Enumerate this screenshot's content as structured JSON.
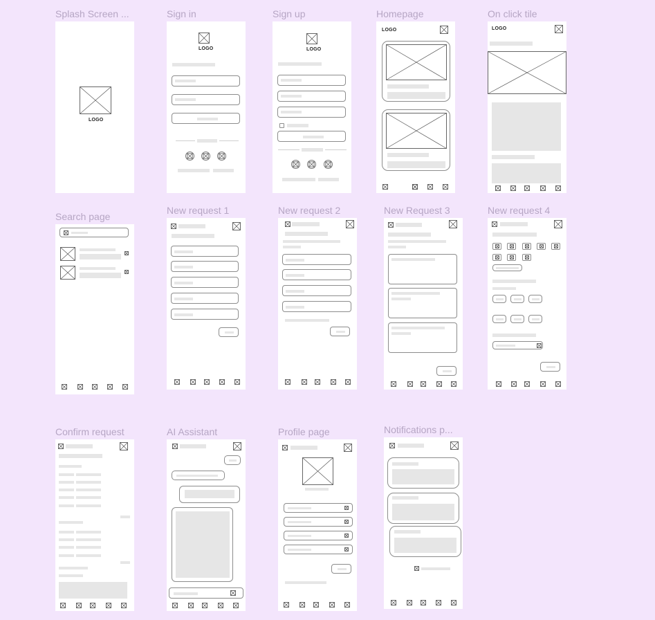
{
  "frames": {
    "splash": {
      "title": "Splash Screen ..."
    },
    "signin": {
      "title": "Sign in"
    },
    "signup": {
      "title": "Sign up"
    },
    "homepage": {
      "title": "Homepage"
    },
    "tile": {
      "title": "On click tile"
    },
    "search": {
      "title": "Search page"
    },
    "nr1": {
      "title": "New request 1"
    },
    "nr2": {
      "title": "New request 2"
    },
    "nr3": {
      "title": "New Request 3"
    },
    "nr4": {
      "title": "New request 4"
    },
    "confirm": {
      "title": "Confirm request"
    },
    "ai": {
      "title": "AI Assistant"
    },
    "profile": {
      "title": "Profile page"
    },
    "notif": {
      "title": "Notifications p..."
    }
  },
  "logo_text": "LOGO"
}
